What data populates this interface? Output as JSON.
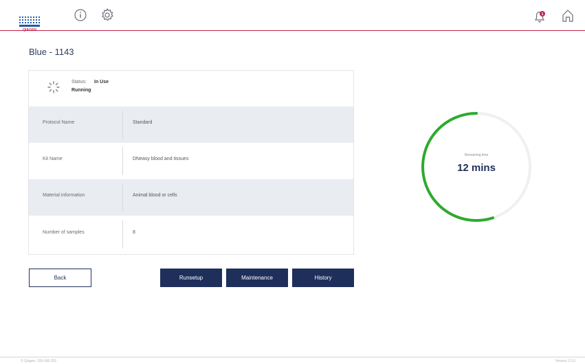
{
  "header": {
    "logo_text": "QIAGEN",
    "notification_count": "1",
    "icons": [
      "info-icon",
      "settings-gear-icon",
      "notification-bell-icon",
      "home-icon"
    ]
  },
  "page_title": "Blue - 1143",
  "status": {
    "label": "Status:",
    "value": "In Use",
    "sub": "Running"
  },
  "details": [
    {
      "key": "Protocol Name",
      "value": "Standard"
    },
    {
      "key": "Kit Name",
      "value": "DNeasy blood and tissues"
    },
    {
      "key": "Material information",
      "value": "Animal blood or cells"
    },
    {
      "key": "Number of samples",
      "value": "8"
    }
  ],
  "buttons": {
    "back": "Back",
    "runsetup": "Runsetup",
    "maintenance": "Maintenance",
    "history": "History"
  },
  "gauge": {
    "caption": "Remaining time",
    "value": "12 mins",
    "progress": 0.55
  },
  "footer": {
    "left": "© Qiagen, 155-000-201",
    "right": "Version 2.0.0"
  },
  "colors": {
    "accent": "#c2224a",
    "primary": "#1f2f5c",
    "gauge": "#2eaa2e"
  }
}
